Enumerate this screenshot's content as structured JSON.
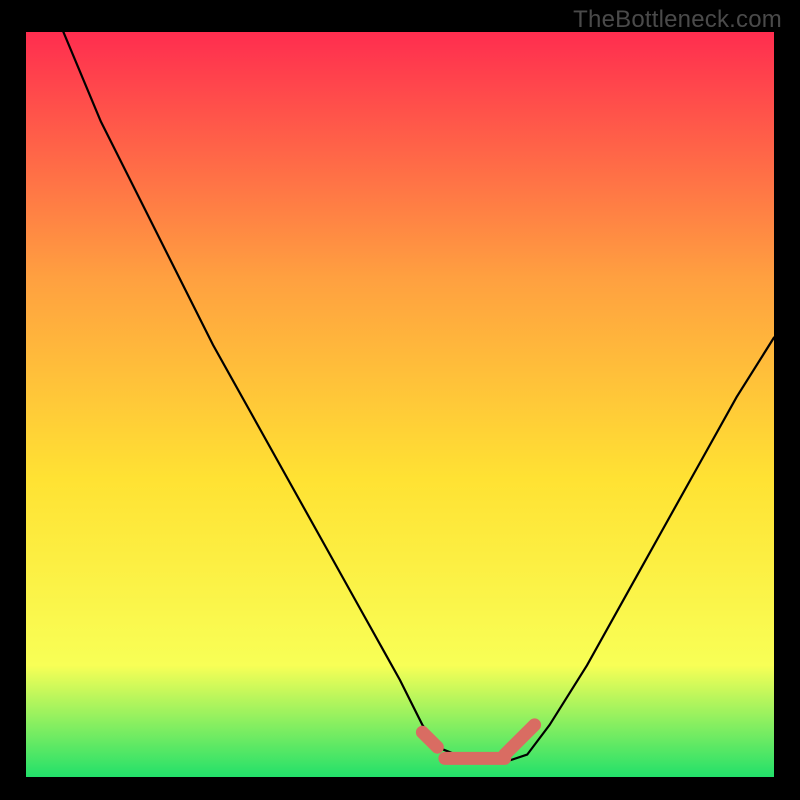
{
  "watermark": "TheBottleneck.com",
  "colors": {
    "background": "#000000",
    "gradient_top": "#ff2d4f",
    "gradient_mid1": "#ffa040",
    "gradient_mid2": "#ffe233",
    "gradient_mid3": "#f8ff56",
    "gradient_bottom": "#22e06a",
    "curve": "#000000",
    "marker": "#d96c62"
  },
  "chart_data": {
    "type": "line",
    "title": "",
    "xlabel": "",
    "ylabel": "",
    "xlim": [
      0,
      100
    ],
    "ylim": [
      0,
      100
    ],
    "series": [
      {
        "name": "bottleneck-curve",
        "x": [
          5,
          10,
          15,
          20,
          25,
          30,
          35,
          40,
          45,
          50,
          53,
          55,
          60,
          64,
          67,
          70,
          75,
          80,
          85,
          90,
          95,
          100
        ],
        "values": [
          100,
          88,
          78,
          68,
          58,
          49,
          40,
          31,
          22,
          13,
          7,
          4,
          2,
          2,
          3,
          7,
          15,
          24,
          33,
          42,
          51,
          59
        ]
      }
    ],
    "markers": {
      "name": "highlighted-range",
      "color": "#d96c62",
      "segments": [
        {
          "x": [
            53,
            55
          ],
          "y": [
            6,
            4
          ]
        },
        {
          "x": [
            56,
            64
          ],
          "y": [
            2.5,
            2.5
          ]
        },
        {
          "x": [
            64,
            68
          ],
          "y": [
            3,
            7
          ]
        }
      ]
    },
    "annotations": []
  }
}
